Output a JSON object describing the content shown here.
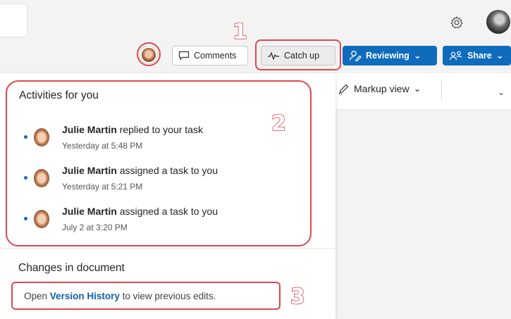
{
  "toolbar": {
    "comments_label": "Comments",
    "catchup_label": "Catch up",
    "reviewing_label": "Reviewing",
    "share_label": "Share"
  },
  "doc_toolbar": {
    "markup_label": "Markup view"
  },
  "callouts": [
    "1",
    "2",
    "3"
  ],
  "activities_pane": {
    "heading": "Activities for you",
    "items": [
      {
        "name": "Julie Martin",
        "action": "replied to your task",
        "time": "Yesterday at 5:48 PM"
      },
      {
        "name": "Julie Martin",
        "action": "assigned a task to you",
        "time": "Yesterday at 5:21 PM"
      },
      {
        "name": "Julie Martin",
        "action": "assigned a task to you",
        "time": "July 2 at 3:20 PM"
      }
    ]
  },
  "changes": {
    "heading": "Changes in document",
    "prefix": "Open",
    "link": "Version History",
    "suffix": "to view previous edits."
  },
  "colors": {
    "accent": "#0f6cbd",
    "annotation": "#e0474c"
  }
}
